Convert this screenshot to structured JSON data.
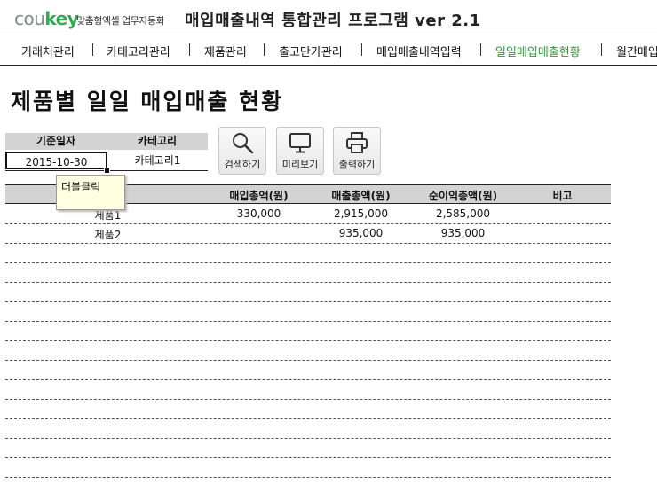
{
  "brand": {
    "logo_prefix": "cou",
    "logo_suffix": "key",
    "slogan": "맞춤형엑셀 업무자동화"
  },
  "app_title": "매입매출내역 통합관리 프로그램 ver 2.1",
  "menu": {
    "items": [
      {
        "label": "거래처관리"
      },
      {
        "label": "카테고리관리"
      },
      {
        "label": "제품관리"
      },
      {
        "label": "출고단가관리"
      },
      {
        "label": "매입매출내역입력"
      },
      {
        "label": "일일매입매출현황"
      },
      {
        "label": "월간매입"
      }
    ],
    "active_color": "#2a9d3a"
  },
  "page_title": "제품별 일일 매입매출 현황",
  "filters": {
    "date_label": "기준일자",
    "date_value": "2015-10-30",
    "category_label": "카테고리",
    "category_value": "카테고리1",
    "tooltip": "더블클릭"
  },
  "buttons": {
    "search": {
      "label": "검색하기",
      "icon": "search-icon"
    },
    "preview": {
      "label": "미리보기",
      "icon": "monitor-icon"
    },
    "print": {
      "label": "출력하기",
      "icon": "printer-icon"
    }
  },
  "grid": {
    "columns": [
      "매입총액(원)",
      "매출총액(원)",
      "순이익총액(원)",
      "비고"
    ],
    "rows": [
      {
        "product": "제품1",
        "purchase": "330,000",
        "sales": "2,915,000",
        "profit": "2,585,000",
        "note": ""
      },
      {
        "product": "제품2",
        "purchase": "",
        "sales": "935,000",
        "profit": "935,000",
        "note": ""
      }
    ]
  }
}
